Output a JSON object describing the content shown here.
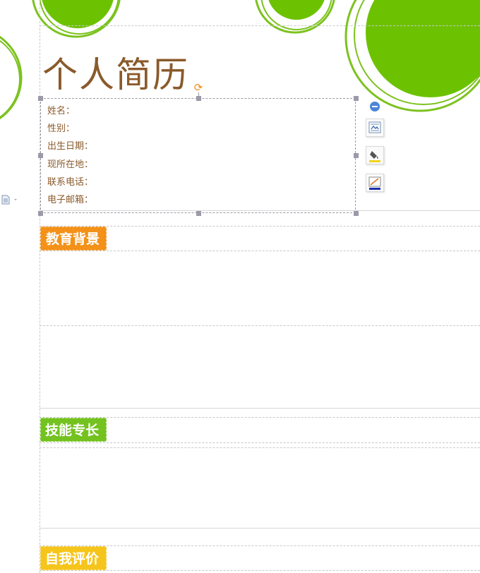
{
  "document": {
    "title": "个人简历",
    "info_fields": [
      {
        "label": "姓名："
      },
      {
        "label": "性别："
      },
      {
        "label": "出生日期："
      },
      {
        "label": "现所在地："
      },
      {
        "label": "联系电话："
      },
      {
        "label": "电子邮箱："
      }
    ],
    "sections": [
      {
        "heading": "教育背景",
        "color": "#f39118"
      },
      {
        "heading": "技能专长",
        "color": "#74c21f"
      },
      {
        "heading": "自我评价",
        "color": "#f6c51b"
      }
    ]
  },
  "floating_toolbar": {
    "icons": [
      "collapse-icon",
      "layout-options-icon",
      "fill-color-icon",
      "line-color-icon"
    ]
  },
  "theme": {
    "decoration_green": "#6cc200",
    "title_brown": "#8a5a2b",
    "handle_gray": "#9a9aa8"
  }
}
